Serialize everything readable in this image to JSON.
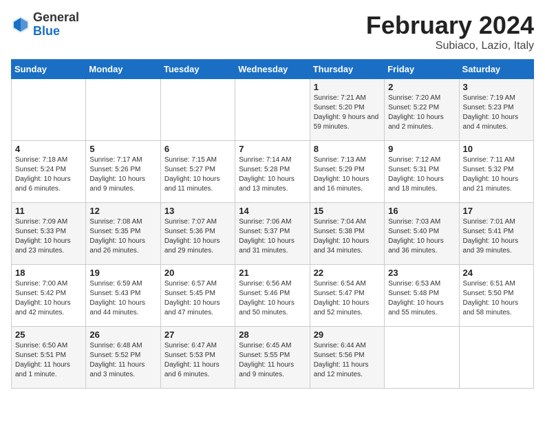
{
  "header": {
    "logo": {
      "general": "General",
      "blue": "Blue"
    },
    "title": "February 2024",
    "subtitle": "Subiaco, Lazio, Italy"
  },
  "weekdays": [
    "Sunday",
    "Monday",
    "Tuesday",
    "Wednesday",
    "Thursday",
    "Friday",
    "Saturday"
  ],
  "weeks": [
    [
      {
        "day": "",
        "info": ""
      },
      {
        "day": "",
        "info": ""
      },
      {
        "day": "",
        "info": ""
      },
      {
        "day": "",
        "info": ""
      },
      {
        "day": "1",
        "info": "Sunrise: 7:21 AM\nSunset: 5:20 PM\nDaylight: 9 hours\nand 59 minutes."
      },
      {
        "day": "2",
        "info": "Sunrise: 7:20 AM\nSunset: 5:22 PM\nDaylight: 10 hours\nand 2 minutes."
      },
      {
        "day": "3",
        "info": "Sunrise: 7:19 AM\nSunset: 5:23 PM\nDaylight: 10 hours\nand 4 minutes."
      }
    ],
    [
      {
        "day": "4",
        "info": "Sunrise: 7:18 AM\nSunset: 5:24 PM\nDaylight: 10 hours\nand 6 minutes."
      },
      {
        "day": "5",
        "info": "Sunrise: 7:17 AM\nSunset: 5:26 PM\nDaylight: 10 hours\nand 9 minutes."
      },
      {
        "day": "6",
        "info": "Sunrise: 7:15 AM\nSunset: 5:27 PM\nDaylight: 10 hours\nand 11 minutes."
      },
      {
        "day": "7",
        "info": "Sunrise: 7:14 AM\nSunset: 5:28 PM\nDaylight: 10 hours\nand 13 minutes."
      },
      {
        "day": "8",
        "info": "Sunrise: 7:13 AM\nSunset: 5:29 PM\nDaylight: 10 hours\nand 16 minutes."
      },
      {
        "day": "9",
        "info": "Sunrise: 7:12 AM\nSunset: 5:31 PM\nDaylight: 10 hours\nand 18 minutes."
      },
      {
        "day": "10",
        "info": "Sunrise: 7:11 AM\nSunset: 5:32 PM\nDaylight: 10 hours\nand 21 minutes."
      }
    ],
    [
      {
        "day": "11",
        "info": "Sunrise: 7:09 AM\nSunset: 5:33 PM\nDaylight: 10 hours\nand 23 minutes."
      },
      {
        "day": "12",
        "info": "Sunrise: 7:08 AM\nSunset: 5:35 PM\nDaylight: 10 hours\nand 26 minutes."
      },
      {
        "day": "13",
        "info": "Sunrise: 7:07 AM\nSunset: 5:36 PM\nDaylight: 10 hours\nand 29 minutes."
      },
      {
        "day": "14",
        "info": "Sunrise: 7:06 AM\nSunset: 5:37 PM\nDaylight: 10 hours\nand 31 minutes."
      },
      {
        "day": "15",
        "info": "Sunrise: 7:04 AM\nSunset: 5:38 PM\nDaylight: 10 hours\nand 34 minutes."
      },
      {
        "day": "16",
        "info": "Sunrise: 7:03 AM\nSunset: 5:40 PM\nDaylight: 10 hours\nand 36 minutes."
      },
      {
        "day": "17",
        "info": "Sunrise: 7:01 AM\nSunset: 5:41 PM\nDaylight: 10 hours\nand 39 minutes."
      }
    ],
    [
      {
        "day": "18",
        "info": "Sunrise: 7:00 AM\nSunset: 5:42 PM\nDaylight: 10 hours\nand 42 minutes."
      },
      {
        "day": "19",
        "info": "Sunrise: 6:59 AM\nSunset: 5:43 PM\nDaylight: 10 hours\nand 44 minutes."
      },
      {
        "day": "20",
        "info": "Sunrise: 6:57 AM\nSunset: 5:45 PM\nDaylight: 10 hours\nand 47 minutes."
      },
      {
        "day": "21",
        "info": "Sunrise: 6:56 AM\nSunset: 5:46 PM\nDaylight: 10 hours\nand 50 minutes."
      },
      {
        "day": "22",
        "info": "Sunrise: 6:54 AM\nSunset: 5:47 PM\nDaylight: 10 hours\nand 52 minutes."
      },
      {
        "day": "23",
        "info": "Sunrise: 6:53 AM\nSunset: 5:48 PM\nDaylight: 10 hours\nand 55 minutes."
      },
      {
        "day": "24",
        "info": "Sunrise: 6:51 AM\nSunset: 5:50 PM\nDaylight: 10 hours\nand 58 minutes."
      }
    ],
    [
      {
        "day": "25",
        "info": "Sunrise: 6:50 AM\nSunset: 5:51 PM\nDaylight: 11 hours\nand 1 minute."
      },
      {
        "day": "26",
        "info": "Sunrise: 6:48 AM\nSunset: 5:52 PM\nDaylight: 11 hours\nand 3 minutes."
      },
      {
        "day": "27",
        "info": "Sunrise: 6:47 AM\nSunset: 5:53 PM\nDaylight: 11 hours\nand 6 minutes."
      },
      {
        "day": "28",
        "info": "Sunrise: 6:45 AM\nSunset: 5:55 PM\nDaylight: 11 hours\nand 9 minutes."
      },
      {
        "day": "29",
        "info": "Sunrise: 6:44 AM\nSunset: 5:56 PM\nDaylight: 11 hours\nand 12 minutes."
      },
      {
        "day": "",
        "info": ""
      },
      {
        "day": "",
        "info": ""
      }
    ]
  ]
}
